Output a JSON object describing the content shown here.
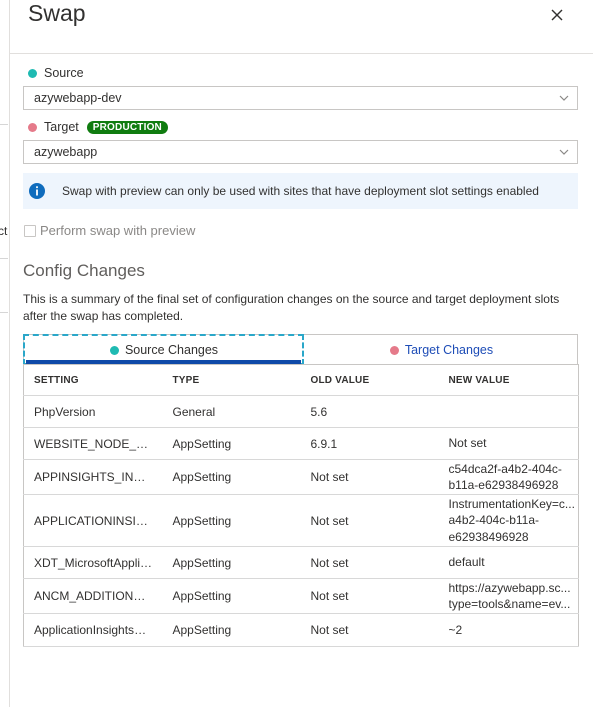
{
  "blade": {
    "title": "Swap",
    "close_label": "close"
  },
  "background": {
    "clipped_text": "ct"
  },
  "source": {
    "label": "Source",
    "value": "azywebapp-dev"
  },
  "target": {
    "label": "Target",
    "badge": "PRODUCTION",
    "value": "azywebapp"
  },
  "info": {
    "message": "Swap with preview can only be used with sites that have deployment slot settings enabled"
  },
  "preview_checkbox": {
    "label": "Perform swap with preview",
    "checked": false
  },
  "config": {
    "title": "Config Changes",
    "summary": "This is a summary of the final set of configuration changes on the source and target deployment slots after the swap has completed.",
    "tabs": [
      {
        "label": "Source Changes",
        "selected": true
      },
      {
        "label": "Target Changes",
        "selected": false
      }
    ],
    "columns": [
      "SETTING",
      "TYPE",
      "OLD VALUE",
      "NEW VALUE"
    ],
    "rows": [
      {
        "setting": "PhpVersion",
        "type": "General",
        "old": "5.6",
        "new": [
          "",
          ""
        ]
      },
      {
        "setting": "WEBSITE_NODE_DEFAULT_VERSION",
        "type": "AppSetting",
        "old": "6.9.1",
        "new": [
          "Not set",
          ""
        ]
      },
      {
        "setting": "APPINSIGHTS_INSTRUMENTATIONKEY",
        "type": "AppSetting",
        "old": "Not set",
        "new": [
          "c54dca2f-a4b2-404c-",
          "b11a-e62938496928"
        ]
      },
      {
        "setting": "APPLICATIONINSIGHTS_CONNECTION_STRING",
        "type": "AppSetting",
        "old": "Not set",
        "new": [
          "InstrumentationKey=c...",
          "a4b2-404c-b11a-",
          "e62938496928"
        ]
      },
      {
        "setting": "XDT_MicrosoftApplicationInsights_Mode",
        "type": "AppSetting",
        "old": "Not set",
        "new": [
          "default",
          ""
        ]
      },
      {
        "setting": "ANCM_ADDITIONAL_ERROR_PAGE_LINK",
        "type": "AppSetting",
        "old": "Not set",
        "new": [
          "https://azywebapp.sc...",
          "type=tools&name=ev..."
        ]
      },
      {
        "setting": "ApplicationInsightsAgent_EXTENSION_VERSION",
        "type": "AppSetting",
        "old": "Not set",
        "new": [
          "~2",
          ""
        ]
      }
    ]
  },
  "colors": {
    "source_dot": "#1fbab2",
    "target_dot": "#e57a8a",
    "badge_bg": "#107c10",
    "info_bg": "#eef5fd",
    "info_icon": "#0f6cbd",
    "tab_underline": "#0f4aa8",
    "target_tab_text": "#1e4db7"
  }
}
